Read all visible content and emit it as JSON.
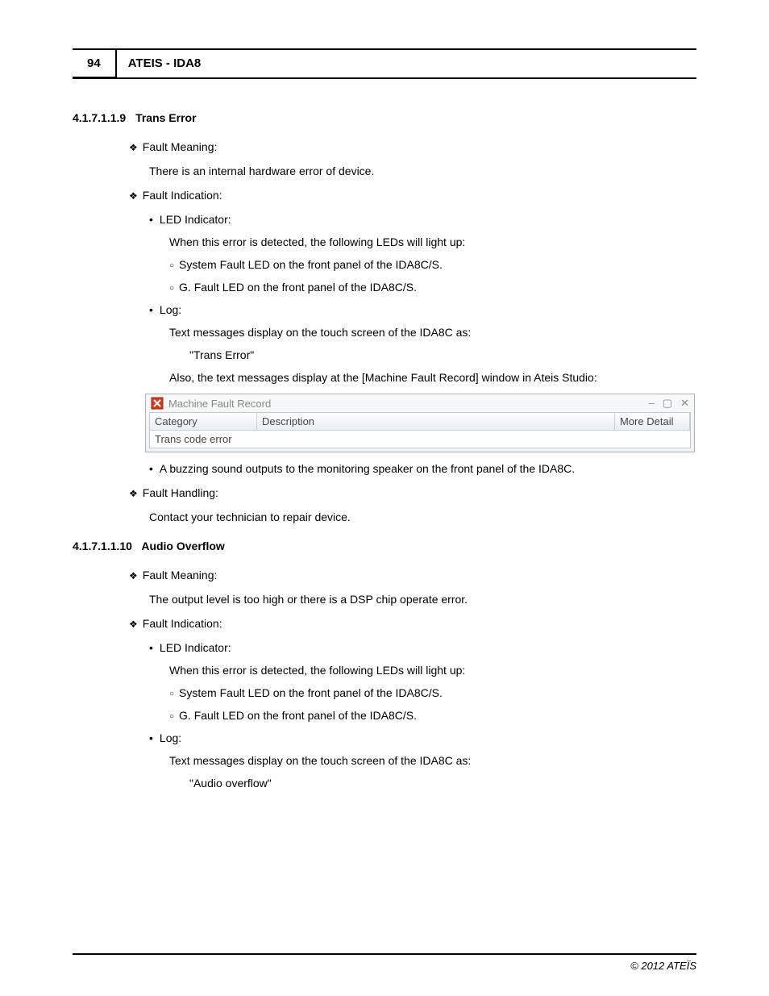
{
  "header": {
    "page_number": "94",
    "title": "ATEIS - IDA8"
  },
  "section1": {
    "number": "4.1.7.1.1.9",
    "title": "Trans Error",
    "fault_meaning_label": "Fault Meaning:",
    "fault_meaning_text": "There is an internal hardware error of device.",
    "fault_indication_label": "Fault Indication:",
    "led_label": "LED Indicator:",
    "led_intro": "When this error is detected, the following LEDs will light up:",
    "led_item1": "System Fault LED on the front panel of the IDA8C/S.",
    "led_item2": "G. Fault LED on the front panel of the IDA8C/S.",
    "log_label": "Log:",
    "log_text1": "Text messages display on the touch screen of the IDA8C as:",
    "log_msg": "\"Trans Error\"",
    "log_text2": "Also, the text messages display at the [Machine Fault Record] window in Ateis Studio:",
    "buzz_text": "A buzzing sound outputs to the monitoring speaker on the front panel of the IDA8C.",
    "fault_handling_label": "Fault Handling:",
    "fault_handling_text": "Contact your technician to repair device."
  },
  "fault_window": {
    "title": "Machine Fault Record",
    "col_category": "Category",
    "col_description": "Description",
    "col_more": "More Detail",
    "row_category": "Trans code error",
    "row_description": "",
    "row_more": ""
  },
  "section2": {
    "number": "4.1.7.1.1.10",
    "title": "Audio Overflow",
    "fault_meaning_label": "Fault Meaning:",
    "fault_meaning_text": "The output level is too high or there is a DSP chip operate error.",
    "fault_indication_label": "Fault Indication:",
    "led_label": "LED Indicator:",
    "led_intro": "When this error is detected, the following LEDs will light up:",
    "led_item1": "System Fault LED on the front panel of the IDA8C/S.",
    "led_item2": "G. Fault LED on the front panel of the IDA8C/S.",
    "log_label": "Log:",
    "log_text1": "Text messages display on the touch screen of the IDA8C as:",
    "log_msg": "\"Audio overflow\""
  },
  "footer": {
    "copyright": "© 2012 ATEÏS"
  }
}
